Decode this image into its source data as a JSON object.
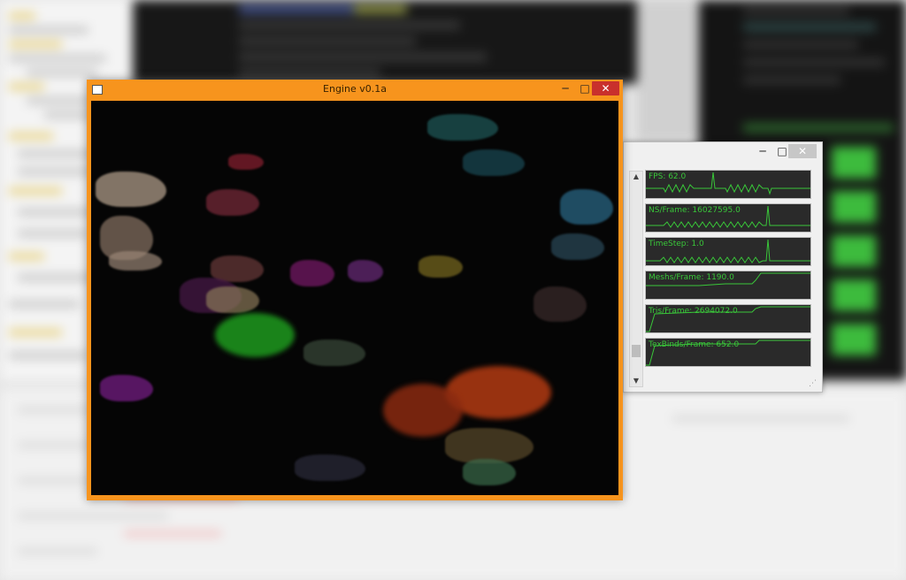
{
  "engine_window": {
    "title": "Engine v0.1a",
    "minimize_glyph": "─",
    "maximize_glyph": "□",
    "close_glyph": "✕",
    "accent_color": "#f7941d",
    "close_color": "#c9302c"
  },
  "stats_window": {
    "minimize_glyph": "─",
    "maximize_glyph": "□",
    "close_glyph": "✕",
    "scroll_up_glyph": "▲",
    "scroll_down_glyph": "▼",
    "resize_grip_glyph": "⋰",
    "graph_color": "#39c639",
    "graphs": [
      {
        "label": "FPS: 62.0"
      },
      {
        "label": "NS/Frame: 16027595.0"
      },
      {
        "label": "TimeStep: 1.0"
      },
      {
        "label": "Meshs/Frame: 1190.0"
      },
      {
        "label": "Tris/Frame: 2694072.0"
      },
      {
        "label": "TexBinds/Frame: 652.0"
      }
    ]
  }
}
